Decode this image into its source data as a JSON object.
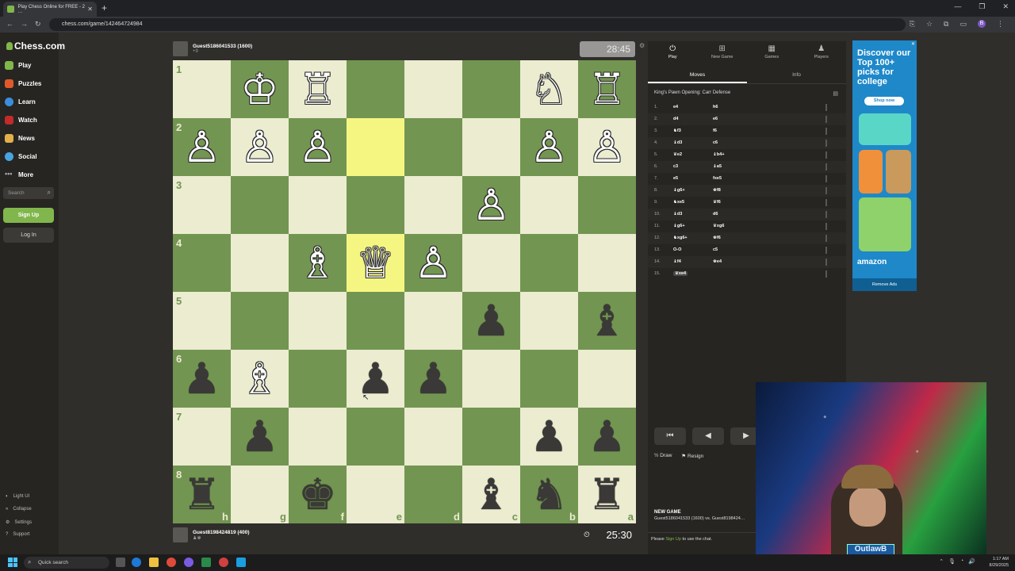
{
  "browser": {
    "tab_title": "Play Chess Online for FREE - 2 …",
    "url": "chess.com/game/142464724984"
  },
  "sidebar": {
    "logo_text": "Chess.com",
    "items": [
      {
        "label": "Play",
        "color": "#81b64c"
      },
      {
        "label": "Puzzles",
        "color": "#e0592a"
      },
      {
        "label": "Learn",
        "color": "#3b8ede"
      },
      {
        "label": "Watch",
        "color": "#c32a2a"
      },
      {
        "label": "News",
        "color": "#e2b04a"
      },
      {
        "label": "Social",
        "color": "#4aa3df"
      },
      {
        "label": "More",
        "color": "#aaaaaa"
      }
    ],
    "search_placeholder": "Search",
    "signup_label": "Sign Up",
    "login_label": "Log In",
    "footer": [
      "Light UI",
      "Collapse",
      "Settings",
      "Support"
    ]
  },
  "top_player": {
    "name": "Guest5186041533 (1600)",
    "sub": "+9",
    "clock": "28:45"
  },
  "bottom_player": {
    "name": "Guest8198424819 (400)",
    "clock": "25:30"
  },
  "board": {
    "ranks": [
      "1",
      "2",
      "3",
      "4",
      "5",
      "6",
      "7",
      "8"
    ],
    "files": [
      "h",
      "g",
      "f",
      "e",
      "d",
      "c",
      "b",
      "a"
    ],
    "highlight": [
      "2-3",
      "4-3"
    ],
    "pieces": {
      "1-1": "♔w",
      "1-2": "♖w",
      "1-6": "♘w",
      "1-7": "♖w",
      "2-0": "♙w",
      "2-1": "♙w",
      "2-2": "♙w",
      "2-6": "♙w",
      "2-7": "♙w",
      "3-5": "♙w",
      "4-2": "♗w",
      "4-3": "♕w",
      "4-4": "♙w",
      "5-5": "♟b",
      "5-7": "♝b",
      "6-0": "♟b",
      "6-1": "♗w",
      "6-3": "♟b",
      "6-4": "♟b",
      "7-1": "♟b",
      "7-6": "♟b",
      "7-7": "♟b",
      "8-0": "♜b",
      "8-2": "♚b",
      "8-5": "♝b",
      "8-6": "♞b",
      "8-7": "♜b"
    }
  },
  "right_panel": {
    "tabs": [
      {
        "icon": "⏻",
        "label": "Play"
      },
      {
        "icon": "⊞",
        "label": "New Game"
      },
      {
        "icon": "▦",
        "label": "Games"
      },
      {
        "icon": "♟",
        "label": "Players"
      }
    ],
    "subtabs": [
      "Moves",
      "Info"
    ],
    "opening": "King's Pawn Opening: Carr Defense",
    "moves": [
      {
        "n": "1.",
        "w": "e4",
        "b": "h6"
      },
      {
        "n": "2.",
        "w": "d4",
        "b": "e6"
      },
      {
        "n": "3.",
        "w": "♞f3",
        "b": "f6"
      },
      {
        "n": "4.",
        "w": "♝d3",
        "b": "c6"
      },
      {
        "n": "5.",
        "w": "♛e2",
        "b": "♝b4+"
      },
      {
        "n": "6.",
        "w": "c3",
        "b": "♝a5"
      },
      {
        "n": "7.",
        "w": "e5",
        "b": "fxe5"
      },
      {
        "n": "8.",
        "w": "♝g6+",
        "b": "♚f8"
      },
      {
        "n": "9.",
        "w": "♞xe5",
        "b": "♛f6"
      },
      {
        "n": "10.",
        "w": "♝d3",
        "b": "d6"
      },
      {
        "n": "11.",
        "w": "♝g6+",
        "b": "♛xg6"
      },
      {
        "n": "12.",
        "w": "♞xg6+",
        "b": "♚f6"
      },
      {
        "n": "13.",
        "w": "O-O",
        "b": "c5"
      },
      {
        "n": "14.",
        "w": "♝f4",
        "b": "♚e4"
      },
      {
        "n": "15.",
        "w": "♛xe4",
        "b": ""
      }
    ],
    "draw_label": "Draw",
    "resign_label": "Resign",
    "new_game_title": "NEW GAME",
    "new_game_line": "Guest5186041533 (1600) vs. Guest8198424…",
    "chat_prefix": "Please",
    "chat_link": "Sign Up",
    "chat_suffix": "to use the chat."
  },
  "ad": {
    "headline": "Discover our Top 100+ picks for college",
    "shop": "Shop now",
    "brand": "amazon",
    "remove": "Remove Ads"
  },
  "webcam": {
    "tag": "OutlawB"
  },
  "taskbar": {
    "search": "Quick search",
    "time": "1:17 AM",
    "date": "8/29/2025"
  }
}
